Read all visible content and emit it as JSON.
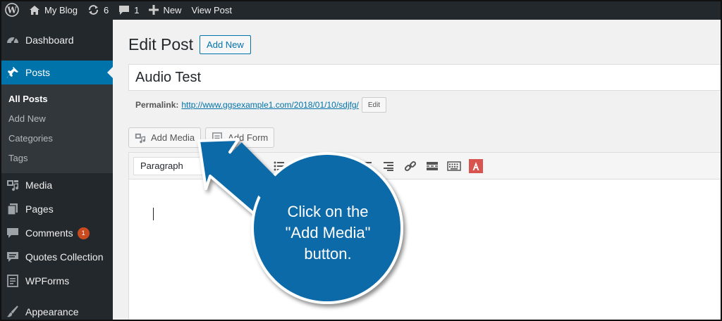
{
  "adminbar": {
    "site_name": "My Blog",
    "updates_count": "6",
    "comments_count": "1",
    "new_label": "New",
    "view_post_label": "View Post"
  },
  "sidebar": {
    "items": [
      {
        "label": "Dashboard",
        "icon": "dashboard-icon"
      },
      {
        "label": "Posts",
        "icon": "pin-icon"
      },
      {
        "label": "Media",
        "icon": "media-icon"
      },
      {
        "label": "Pages",
        "icon": "pages-icon"
      },
      {
        "label": "Comments",
        "icon": "comment-icon",
        "badge": "1"
      },
      {
        "label": "Quotes Collection",
        "icon": "quotes-icon"
      },
      {
        "label": "WPForms",
        "icon": "forms-icon"
      },
      {
        "label": "Appearance",
        "icon": "brush-icon"
      }
    ],
    "submenu": [
      "All Posts",
      "Add New",
      "Categories",
      "Tags"
    ]
  },
  "main": {
    "page_title": "Edit Post",
    "add_new_label": "Add New",
    "post_title": "Audio Test",
    "permalink_label": "Permalink:",
    "permalink_url": "http://www.ggsexample1.com/2018/01/10/sdjfg/",
    "edit_label": "Edit",
    "add_media_label": "Add Media",
    "add_form_label": "Add Form",
    "format_value": "Paragraph"
  },
  "callout": {
    "line1": "Click on the",
    "line2": "\"Add Media\"",
    "line3": "button."
  },
  "colors": {
    "admin_bg": "#23282d",
    "active_blue": "#0073aa",
    "callout_blue": "#0e6aa8",
    "badge_red": "#ca4a1f"
  }
}
